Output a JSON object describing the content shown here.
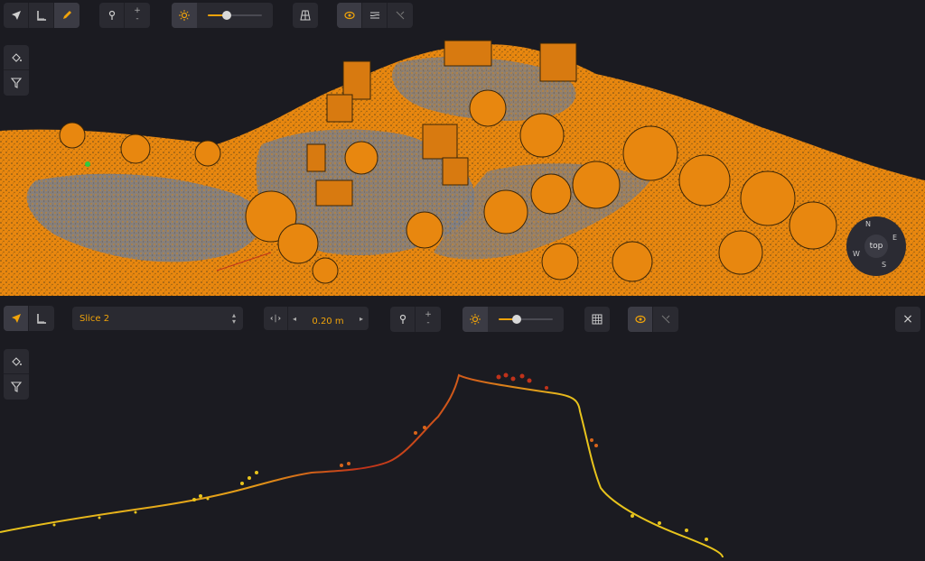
{
  "toolbar_top": {
    "tools": [
      "navigate-tool",
      "measure-tool",
      "draw-tool"
    ],
    "point_size_plus": "+",
    "point_size_minus": "-",
    "brightness_level": 0.3,
    "compass": {
      "center_label": "top",
      "n": "N",
      "e": "E",
      "s": "S",
      "w": "W"
    }
  },
  "section": {
    "slice_name": "Slice 2",
    "thickness": "0.20 m",
    "point_size_plus": "+",
    "point_size_minus": "-",
    "brightness_level": 0.35,
    "close_label": "×"
  },
  "colors": {
    "accent": "#f0a30a",
    "background": "#1b1b21",
    "panel": "#2a2a31",
    "cloud_orange": "#e8870f",
    "cloud_gray": "#7d7f86",
    "profile_red": "#c0321a",
    "profile_yellow": "#e8c41c"
  }
}
